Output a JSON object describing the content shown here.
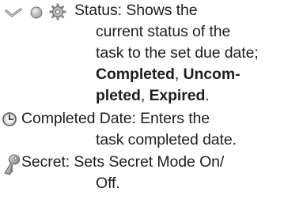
{
  "items": {
    "status": {
      "icons": [
        "checkmark-icon",
        "radio-circle-icon",
        "gear-icon"
      ],
      "line1": "Status: Shows the",
      "line2": "current status of the",
      "line3": "task to the set due date;",
      "line4_a": "Completed",
      "line4_sep": ", ",
      "line4_b": "Uncom-",
      "line5_a": "pleted",
      "line5_sep": ", ",
      "line5_b": "Expired",
      "line5_end": "."
    },
    "completed_date": {
      "icon": "clock-icon",
      "line1": "Completed Date: Enters the",
      "line2": "task completed date."
    },
    "secret": {
      "icon": "key-icon",
      "line1": "Secret: Sets Secret Mode On/",
      "line2": "Off."
    }
  }
}
